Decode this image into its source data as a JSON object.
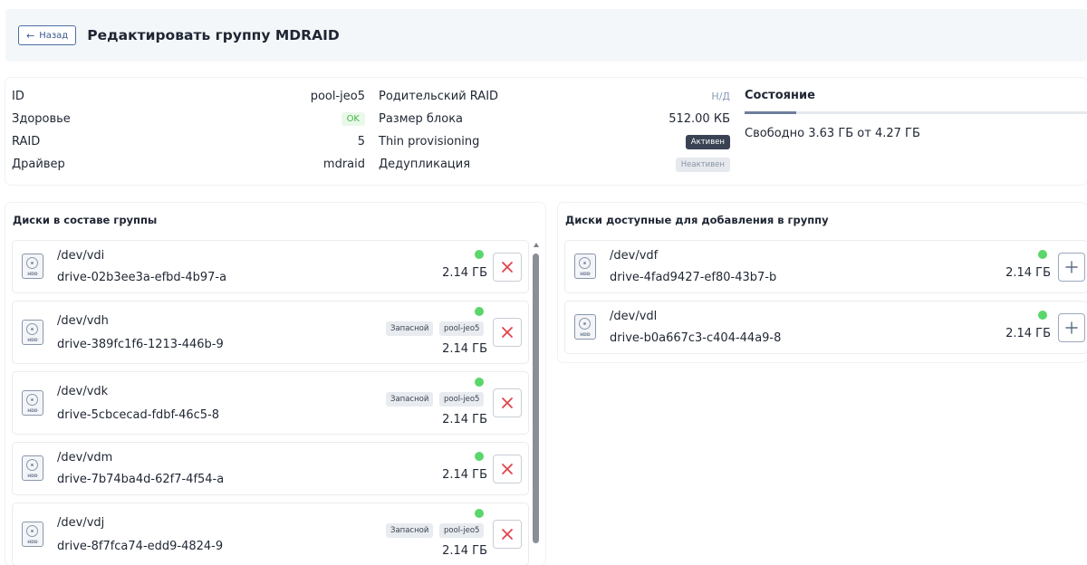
{
  "header": {
    "back_label": "Назад",
    "title": "Редактировать группу MDRAID"
  },
  "info": {
    "left": [
      {
        "label": "ID",
        "value": "pool-jeo5"
      },
      {
        "label": "Здоровье",
        "value": "OK"
      },
      {
        "label": "RAID",
        "value": "5"
      },
      {
        "label": "Драйвер",
        "value": "mdraid"
      }
    ],
    "right": [
      {
        "label": "Родительский RAID",
        "value": "Н/Д"
      },
      {
        "label": "Размер блока",
        "value": "512.00 КБ"
      },
      {
        "label": "Thin provisioning",
        "value": "Активен"
      },
      {
        "label": "Дедупликация",
        "value": "Неактивен"
      }
    ],
    "state": {
      "title": "Состояние",
      "used_fraction": 0.15,
      "text": "Свободно 3.63 ГБ от 4.27 ГБ"
    }
  },
  "member_disks": {
    "title": "Диски в составе группы",
    "disks": [
      {
        "dev": "/dev/vdi",
        "drive": "drive-02b3ee3a-efbd-4b97-a",
        "size": "2.14 ГБ",
        "tags": []
      },
      {
        "dev": "/dev/vdh",
        "drive": "drive-389fc1f6-1213-446b-9",
        "size": "2.14 ГБ",
        "tags": [
          "Запасной",
          "pool-jeo5"
        ]
      },
      {
        "dev": "/dev/vdk",
        "drive": "drive-5cbcecad-fdbf-46c5-8",
        "size": "2.14 ГБ",
        "tags": [
          "Запасной",
          "pool-jeo5"
        ]
      },
      {
        "dev": "/dev/vdm",
        "drive": "drive-7b74ba4d-62f7-4f54-a",
        "size": "2.14 ГБ",
        "tags": []
      },
      {
        "dev": "/dev/vdj",
        "drive": "drive-8f7fca74-edd9-4824-9",
        "size": "2.14 ГБ",
        "tags": [
          "Запасной",
          "pool-jeo5"
        ]
      }
    ]
  },
  "available_disks": {
    "title": "Диски доступные для добавления в группу",
    "disks": [
      {
        "dev": "/dev/vdf",
        "drive": "drive-4fad9427-ef80-43b7-b",
        "size": "2.14 ГБ"
      },
      {
        "dev": "/dev/vdl",
        "drive": "drive-b0a667c3-c404-44a9-8",
        "size": "2.14 ГБ"
      }
    ]
  },
  "icons": {
    "hdd_label": "HDD",
    "status_color": "#5ad66b",
    "remove_color": "#e0444d"
  }
}
